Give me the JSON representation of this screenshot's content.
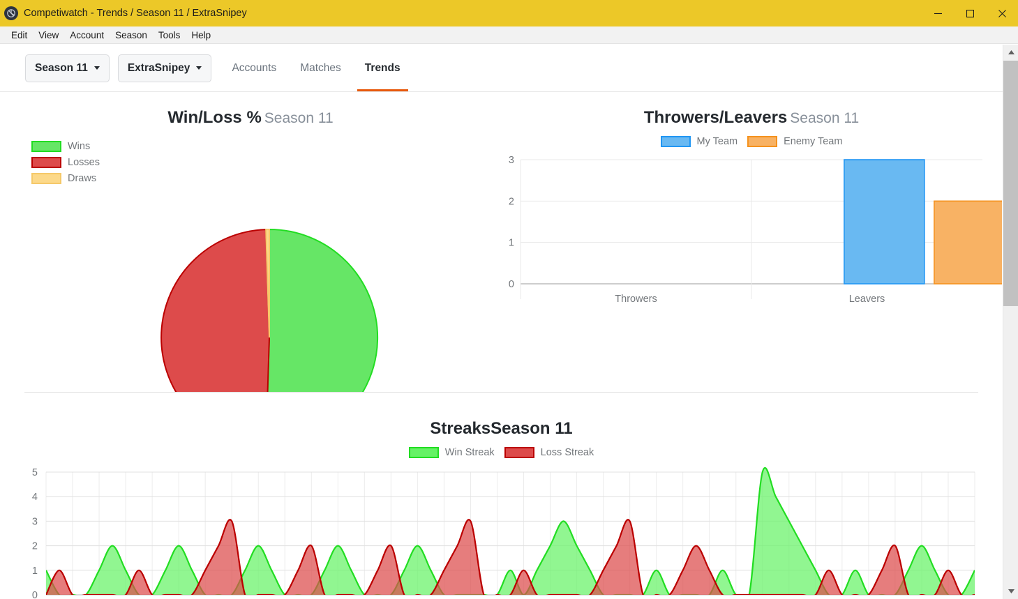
{
  "window": {
    "title": "Competiwatch - Trends / Season 11 / ExtraSnipey",
    "app_icon": "competiwatch-logo-icon",
    "minimize_label": "–",
    "maximize_label": "□",
    "close_label": "✕",
    "titlebar_color": "#ecc828"
  },
  "menubar": {
    "items": [
      {
        "label": "Edit"
      },
      {
        "label": "View"
      },
      {
        "label": "Account"
      },
      {
        "label": "Season"
      },
      {
        "label": "Tools"
      },
      {
        "label": "Help"
      }
    ]
  },
  "toolbar": {
    "season_selector": "Season 11",
    "account_selector": "ExtraSnipey",
    "tabs": [
      {
        "label": "Accounts",
        "active": false
      },
      {
        "label": "Matches",
        "active": false
      },
      {
        "label": "Trends",
        "active": true
      }
    ],
    "active_tab_color": "#e8590c"
  },
  "scrollbar": {
    "up_arrow": "▲",
    "down_arrow": "▼"
  },
  "charts": {
    "winloss": {
      "title": "Win/Loss %",
      "season": "Season 11",
      "legend": [
        {
          "label": "Wins",
          "fill": "#66e666",
          "stroke": "#22dd22"
        },
        {
          "label": "Losses",
          "fill": "#dd4b4b",
          "stroke": "#bb0000"
        },
        {
          "label": "Draws",
          "fill": "#fcd98a",
          "stroke": "#f5c96a"
        }
      ]
    },
    "throwers_leavers": {
      "title": "Throwers/Leavers",
      "season": "Season 11",
      "legend": [
        {
          "label": "My Team",
          "fill": "#69b9f2",
          "stroke": "#2196f3"
        },
        {
          "label": "Enemy Team",
          "fill": "#f8b264",
          "stroke": "#f5921e"
        }
      ]
    },
    "streaks": {
      "title": "Streaks",
      "season": "Season 11",
      "legend": [
        {
          "label": "Win Streak",
          "fill": "#66f266",
          "stroke": "#22dd22"
        },
        {
          "label": "Loss Streak",
          "fill": "#dd4b4b",
          "stroke": "#bb0000"
        }
      ]
    }
  },
  "chart_data": [
    {
      "type": "pie",
      "title": "Win/Loss %",
      "subtitle": "Season 11",
      "legend_position": "left",
      "labels": [
        "Wins",
        "Losses",
        "Draws"
      ],
      "values": [
        50.5,
        49.0,
        0.5
      ],
      "colors": [
        "#66e666",
        "#dd4b4b",
        "#fcd98a"
      ],
      "stroke_colors": [
        "#22dd22",
        "#bb0000",
        "#f5c96a"
      ],
      "start_angle_deg": 0
    },
    {
      "type": "bar",
      "title": "Throwers/Leavers",
      "subtitle": "Season 11",
      "categories": [
        "Throwers",
        "Leavers"
      ],
      "series": [
        {
          "name": "My Team",
          "values": [
            0,
            3
          ],
          "color": "#69b9f2",
          "stroke": "#2196f3"
        },
        {
          "name": "Enemy Team",
          "values": [
            0,
            2
          ],
          "color": "#f8b264",
          "stroke": "#f5921e"
        }
      ],
      "ylim": [
        0,
        3
      ],
      "yticks": [
        0,
        1,
        2,
        3
      ],
      "xlabel": "",
      "ylabel": "",
      "grid": true,
      "legend_position": "top"
    },
    {
      "type": "area",
      "title": "Streaks",
      "subtitle": "Season 11",
      "ylim": [
        0,
        5
      ],
      "yticks": [
        0,
        1,
        2,
        3,
        4,
        5
      ],
      "grid": true,
      "legend_position": "top",
      "xlabel": "",
      "ylabel": "",
      "series": [
        {
          "name": "Win Streak",
          "color": "#66f266",
          "stroke": "#22dd22",
          "values": [
            1,
            0,
            0,
            0,
            1,
            2,
            1,
            0,
            0,
            1,
            2,
            1,
            0,
            0,
            0,
            1,
            2,
            1,
            0,
            0,
            0,
            1,
            2,
            1,
            0,
            0,
            0,
            1,
            2,
            1,
            0,
            0,
            0,
            0,
            0,
            1,
            0,
            1,
            2,
            3,
            2,
            1,
            0,
            0,
            0,
            0,
            1,
            0,
            0,
            0,
            0,
            1,
            0,
            0,
            5,
            4,
            3,
            2,
            1,
            0,
            0,
            1,
            0,
            0,
            0,
            1,
            2,
            1,
            0,
            0,
            1
          ]
        },
        {
          "name": "Loss Streak",
          "color": "#dd4b4b",
          "stroke": "#bb0000",
          "values": [
            0,
            1,
            0,
            0,
            0,
            0,
            0,
            1,
            0,
            0,
            0,
            0,
            1,
            2,
            3,
            0,
            0,
            0,
            0,
            1,
            2,
            0,
            0,
            0,
            0,
            1,
            2,
            0,
            0,
            0,
            1,
            2,
            3,
            0,
            0,
            0,
            1,
            0,
            0,
            0,
            0,
            0,
            1,
            2,
            3,
            0,
            0,
            0,
            1,
            2,
            1,
            0,
            0,
            0,
            0,
            0,
            0,
            0,
            0,
            1,
            0,
            0,
            0,
            1,
            2,
            0,
            0,
            0,
            1,
            0,
            0
          ]
        }
      ]
    }
  ]
}
